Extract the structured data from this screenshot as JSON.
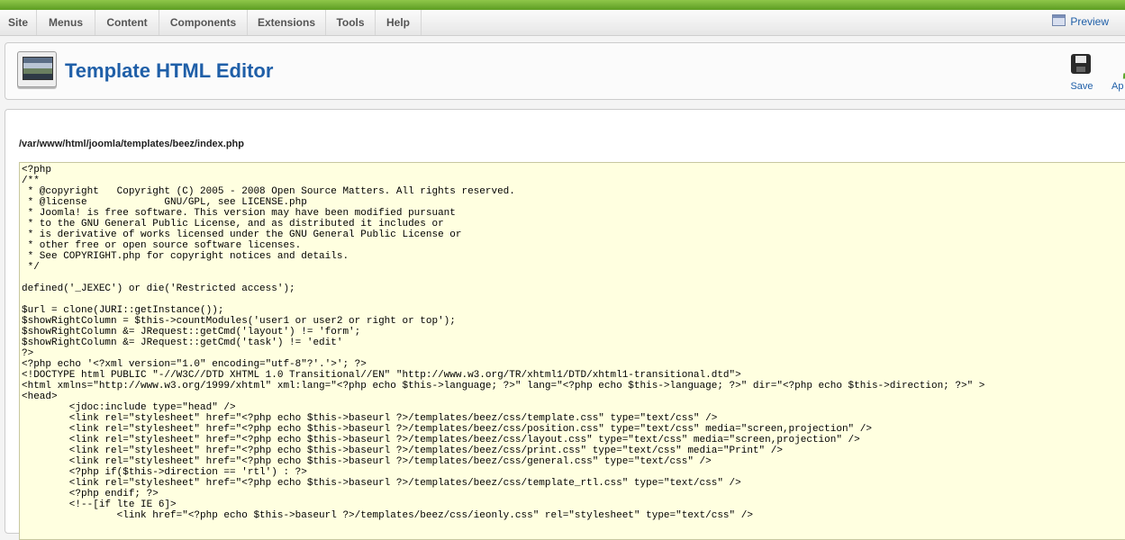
{
  "menu": {
    "items": [
      "Site",
      "Menus",
      "Content",
      "Components",
      "Extensions",
      "Tools",
      "Help"
    ],
    "preview_label": "Preview"
  },
  "toolbar": {
    "title": "Template HTML Editor",
    "save_label": "Save",
    "apply_label": "Ap"
  },
  "editor": {
    "file_path": "/var/www/html/joomla/templates/beez/index.php",
    "lines": [
      "<?php",
      "/**",
      " * @copyright   Copyright (C) 2005 - 2008 Open Source Matters. All rights reserved.",
      " * @license             GNU/GPL, see LICENSE.php",
      " * Joomla! is free software. This version may have been modified pursuant",
      " * to the GNU General Public License, and as distributed it includes or",
      " * is derivative of works licensed under the GNU General Public License or",
      " * other free or open source software licenses.",
      " * See COPYRIGHT.php for copyright notices and details.",
      " */",
      "",
      "defined('_JEXEC') or die('Restricted access');",
      "",
      "$url = clone(JURI::getInstance());",
      "$showRightColumn = $this->countModules('user1 or user2 or right or top');",
      "$showRightColumn &= JRequest::getCmd('layout') != 'form';",
      "$showRightColumn &= JRequest::getCmd('task') != 'edit'",
      "?>",
      "<?php echo '<?xml version=\"1.0\" encoding=\"utf-8\"?'.'>'; ?>",
      "<!DOCTYPE html PUBLIC \"-//W3C//DTD XHTML 1.0 Transitional//EN\" \"http://www.w3.org/TR/xhtml1/DTD/xhtml1-transitional.dtd\">",
      "<html xmlns=\"http://www.w3.org/1999/xhtml\" xml:lang=\"<?php echo $this->language; ?>\" lang=\"<?php echo $this->language; ?>\" dir=\"<?php echo $this->direction; ?>\" >",
      "<head>",
      "        <jdoc:include type=\"head\" />",
      "        <link rel=\"stylesheet\" href=\"<?php echo $this->baseurl ?>/templates/beez/css/template.css\" type=\"text/css\" />",
      "        <link rel=\"stylesheet\" href=\"<?php echo $this->baseurl ?>/templates/beez/css/position.css\" type=\"text/css\" media=\"screen,projection\" />",
      "        <link rel=\"stylesheet\" href=\"<?php echo $this->baseurl ?>/templates/beez/css/layout.css\" type=\"text/css\" media=\"screen,projection\" />",
      "        <link rel=\"stylesheet\" href=\"<?php echo $this->baseurl ?>/templates/beez/css/print.css\" type=\"text/css\" media=\"Print\" />",
      "        <link rel=\"stylesheet\" href=\"<?php echo $this->baseurl ?>/templates/beez/css/general.css\" type=\"text/css\" />",
      "        <?php if($this->direction == 'rtl') : ?>",
      "        <link rel=\"stylesheet\" href=\"<?php echo $this->baseurl ?>/templates/beez/css/template_rtl.css\" type=\"text/css\" />",
      "        <?php endif; ?>",
      "        <!--[if lte IE 6]>",
      "                <link href=\"<?php echo $this->baseurl ?>/templates/beez/css/ieonly.css\" rel=\"stylesheet\" type=\"text/css\" />"
    ]
  }
}
